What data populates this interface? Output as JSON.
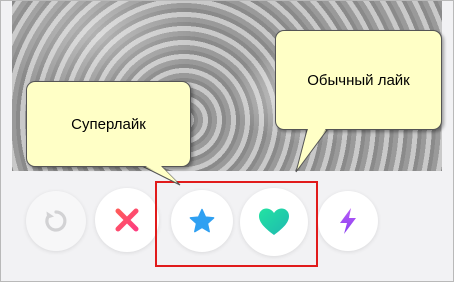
{
  "callouts": {
    "superlike": "Суперлайк",
    "like": "Обычный лайк"
  },
  "buttons": [
    {
      "name": "rewind-button",
      "icon": "rewind-icon",
      "color": "#d6d6d8"
    },
    {
      "name": "nope-button",
      "icon": "close-icon",
      "color": "#fe4a6c"
    },
    {
      "name": "super-like-button",
      "icon": "star-icon",
      "color": "#2fa0f2"
    },
    {
      "name": "like-button",
      "icon": "heart-icon",
      "color": "#28d9a6"
    },
    {
      "name": "boost-button",
      "icon": "lightning-icon",
      "color": "#a448f6"
    }
  ],
  "highlight_color": "#e11b1b"
}
